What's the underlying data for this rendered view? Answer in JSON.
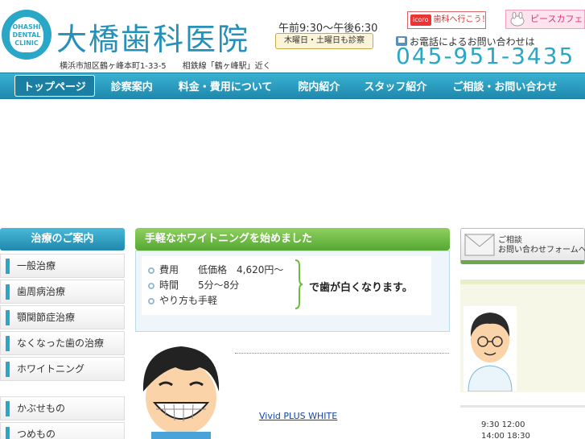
{
  "header": {
    "logo_lines": [
      "OHASHI",
      "DENTAL",
      "CLINIC"
    ],
    "clinic_name": "大橋歯科医院",
    "address": "横浜市旭区鶴ヶ峰本町1-33-5　　相鉄線「鶴ヶ峰駅」近く",
    "hours": "午前9:30～午後6:30",
    "open_days": "木曜日・土曜日も診察",
    "banner_dental_tag": "icoro",
    "banner_dental": "歯科へ行こう！",
    "banner_peace": "ピースカフェ",
    "phone_label": "お電話によるお問い合わせは",
    "phone_number": "045-951-3435"
  },
  "nav": {
    "items": [
      {
        "label": "トップページ"
      },
      {
        "label": "診察案内"
      },
      {
        "label": "料金・費用について"
      },
      {
        "label": "院内紹介"
      },
      {
        "label": "スタッフ紹介"
      },
      {
        "label": "ご相談・お問い合わせ"
      }
    ]
  },
  "sidebar": {
    "heading": "治療のご案内",
    "items": [
      {
        "label": "一般治療"
      },
      {
        "label": "歯周病治療"
      },
      {
        "label": "顎関節症治療"
      },
      {
        "label": "なくなった歯の治療"
      },
      {
        "label": "ホワイトニング"
      },
      {
        "label": "かぶせもの"
      },
      {
        "label": "つめもの"
      }
    ]
  },
  "main": {
    "heading": "手軽なホワイトニングを始めました",
    "rows": [
      {
        "label": "費用",
        "value": "低価格　4,620円～"
      },
      {
        "label": "時間",
        "value": "5分～8分"
      },
      {
        "label": "",
        "value": "やり方も手軽"
      }
    ],
    "result": "で歯が白くなります。",
    "product_link": "Vivid PLUS WHITE"
  },
  "right": {
    "contact_line1": "ご相談",
    "contact_line2": "お問い合わせフォームへ",
    "schedule": [
      "9:30 12:00",
      "14:00 18:30"
    ]
  },
  "colors": {
    "brand_blue": "#2aa6c6",
    "nav_blue": "#1e89ad",
    "heading_green": "#56a833"
  }
}
